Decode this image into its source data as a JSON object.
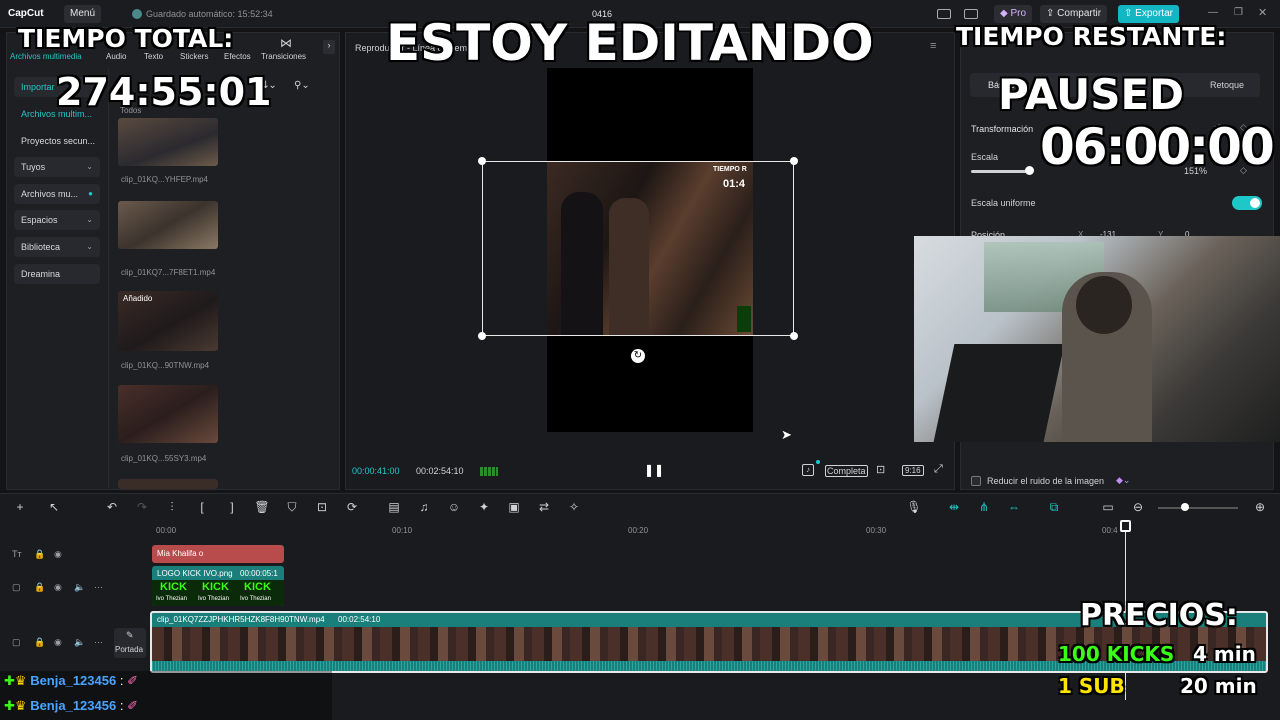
{
  "app": {
    "name": "CapCut",
    "menu_label": "Menú",
    "autosave": "Guardado automático: 15:52:34",
    "project_name": "0416",
    "pro_label": "Pro",
    "share_label": "Compartir",
    "export_label": "Exportar"
  },
  "media_tabs": [
    {
      "label": "Archivos multimedia"
    },
    {
      "label": "Audio"
    },
    {
      "label": "Texto"
    },
    {
      "label": "Stickers"
    },
    {
      "label": "Efectos"
    },
    {
      "label": "Transiciones"
    }
  ],
  "sidebar": {
    "items": [
      {
        "label": "Importar"
      },
      {
        "label": "Archivos multim..."
      },
      {
        "label": "Proyectos secun..."
      },
      {
        "label": "Tuyos"
      },
      {
        "label": "Archivos mu..."
      },
      {
        "label": "Espacios"
      },
      {
        "label": "Biblioteca"
      },
      {
        "label": "Dreamina"
      }
    ]
  },
  "media": {
    "filter_label": "Todos",
    "clips": [
      {
        "name": "clip_01KQ...YHFEP.mp4",
        "badge": ""
      },
      {
        "name": "clip_01KQ7...7F8ET1.mp4",
        "badge": ""
      },
      {
        "name": "clip_01KQ...90TNW.mp4",
        "badge": "Añadido"
      },
      {
        "name": "clip_01KQ...55SY3.mp4",
        "badge": ""
      }
    ]
  },
  "player": {
    "title": "Reproductor - Línea de tiempo",
    "current_time": "00:00:41:00",
    "total_time": "00:02:54:10",
    "full_label": "Completa",
    "ratio_label": "9:16",
    "video_overlay_title": "TIEMPO R",
    "video_overlay_time": "01:4"
  },
  "inspector": {
    "tab_basic": "Básico",
    "tab_other": "Retoque",
    "transform_label": "Transformación",
    "scale_label": "Escala",
    "scale_value": "151%",
    "scale_fraction": 0.51,
    "uniform_label": "Escala uniforme",
    "position_label": "Posición",
    "pos_x_label": "X",
    "pos_x_value": "-131",
    "pos_y_label": "Y",
    "pos_y_value": "0",
    "noise_label": "Reducir el ruido de la imagen"
  },
  "timeline": {
    "ruler": [
      "00:00",
      "00:10",
      "00:20",
      "00:30",
      "00:4"
    ],
    "text_clip": "Mia Khalifa o",
    "logo_clip_name": "LOGO KICK IVO.png",
    "logo_clip_time": "00:00:05:1",
    "logo_text": "KICK",
    "logo_sub": "Ivo Thezian",
    "main_clip_name": "clip_01KQ7ZZJPHKHR5HZK8F8H90TNW.mp4",
    "main_clip_time": "00:02:54:10",
    "cover_label": "Portada"
  },
  "overlays": {
    "total_label": "TIEMPO TOTAL:",
    "total_value": "274:55:01",
    "editing_label": "ESTOY EDITANDO",
    "remaining_label": "TIEMPO RESTANTE:",
    "status": "PAUSED",
    "remaining_value": "06:00:00",
    "prices_label": "PRECIOS:",
    "price_1_item": "100 KICKS",
    "price_1_value": "4 min",
    "price_2_item": "1 SUB",
    "price_2_value": "20 min"
  },
  "chat": [
    {
      "user": "Benja_123456",
      "sep": ":"
    },
    {
      "user": "Benja_123456",
      "sep": ":"
    }
  ],
  "colors": {
    "accent": "#1ec8c8",
    "export": "#13b6c3",
    "timeline_clip": "#1a7f7a",
    "text_clip": "#b84c4c",
    "price_item": "#39ff14",
    "price_sub": "#ffe400"
  }
}
